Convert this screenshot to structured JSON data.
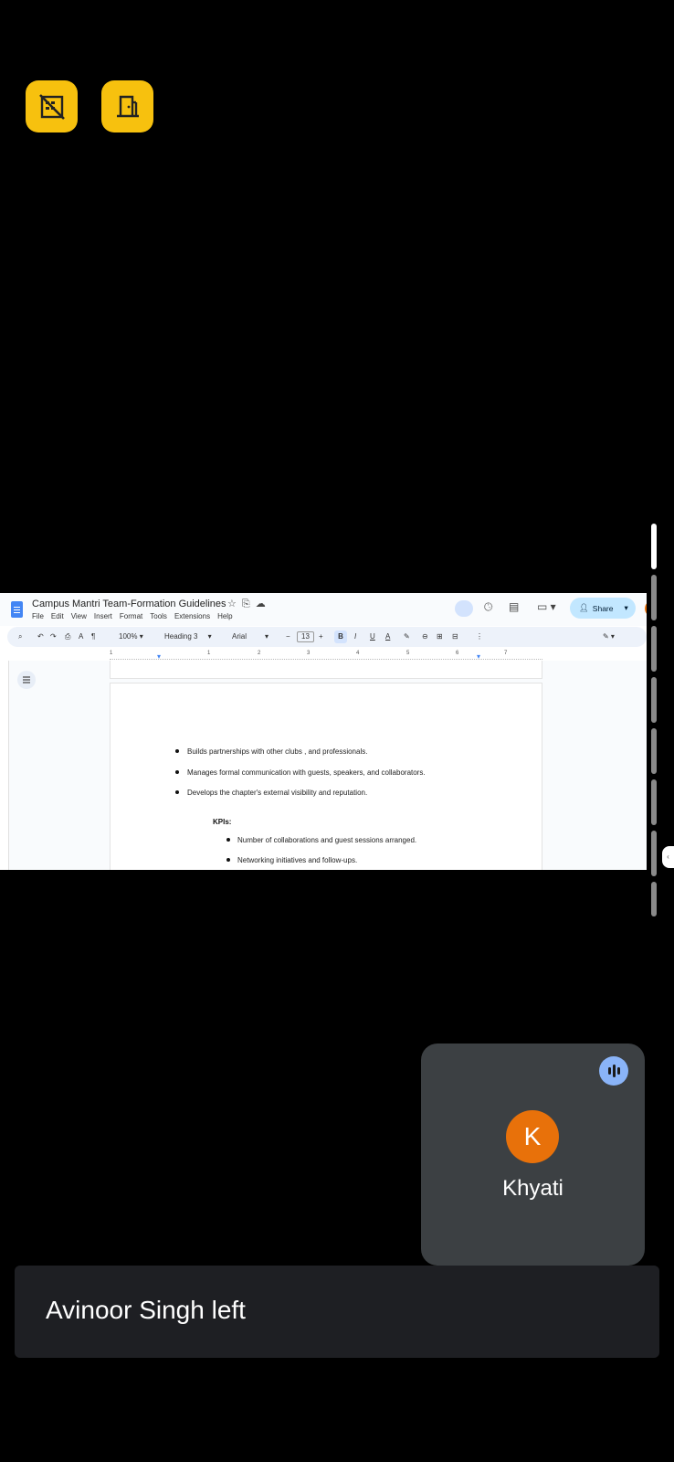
{
  "overlay_buttons": [
    {
      "name": "no-building-icon"
    },
    {
      "name": "door-exit-icon"
    }
  ],
  "doc": {
    "title": "Campus Mantri Team-Formation Guidelines",
    "menus": [
      "File",
      "Edit",
      "View",
      "Insert",
      "Format",
      "Tools",
      "Extensions",
      "Help"
    ],
    "share_label": "Share",
    "toolbar": {
      "zoom": "100%",
      "style": "Heading 3",
      "font": "Arial",
      "size": "13",
      "bold": "B",
      "italic": "I",
      "underline": "U",
      "text_color": "A"
    },
    "ruler_marks": [
      "1",
      "1",
      "2",
      "3",
      "4",
      "5",
      "6",
      "7"
    ],
    "bullets": [
      "Builds partnerships with other clubs , and  professionals.",
      "Manages formal communication with guests, speakers, and collaborators.",
      "Develops the chapter's external visibility and reputation."
    ],
    "kpi_label": "KPIs:",
    "kpi_bullets": [
      "Number of collaborations and guest sessions arranged.",
      "Networking initiatives and follow-ups."
    ]
  },
  "participant": {
    "initial": "K",
    "name": "Khyati",
    "avatar_color": "#e8710a"
  },
  "toast": {
    "text": "Avinoor Singh left"
  }
}
